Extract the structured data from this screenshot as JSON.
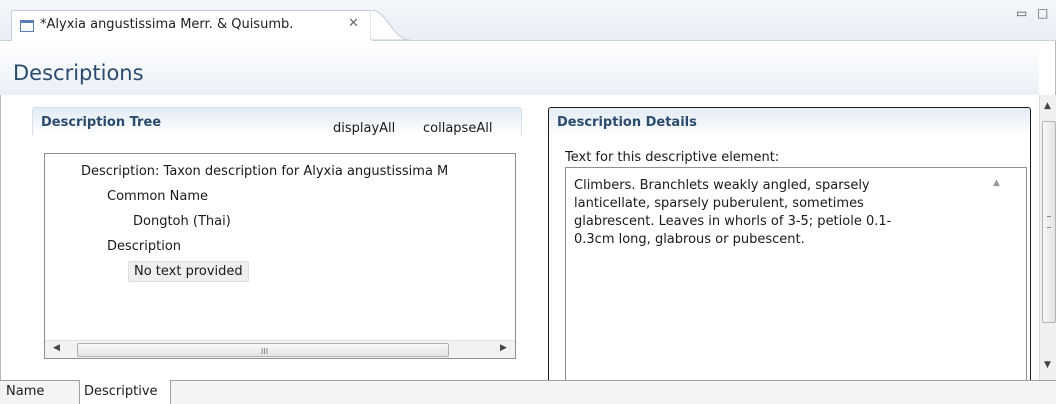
{
  "editor": {
    "tab_title": "*Alyxia angustissima Merr. & Quisumb.",
    "tab_close_glyph": "✕",
    "minimize_glyph": "▭",
    "maximize_glyph": "□"
  },
  "form": {
    "title": "Descriptions"
  },
  "tree_section": {
    "title": "Description Tree",
    "display_all": "displayAll",
    "collapse_all": "collapseAll",
    "items": [
      "Description: Taxon description for Alyxia angustissima M",
      "Common Name",
      "Dongtoh (Thai)",
      "Description",
      "No text provided"
    ],
    "hscroll_grip": "III"
  },
  "details_section": {
    "title": "Description Details",
    "field_label": "Text for this descriptive element:",
    "text_lines": [
      "Climbers. Branchlets weakly angled, sparsely",
      "lanticellate, sparsely puberulent, sometimes",
      "glabrescent. Leaves in whorls of 3-5; petiole 0.1-",
      "0.3cm long, glabrous or pubescent."
    ]
  },
  "bottom_tabs": [
    "Name",
    "Descriptive"
  ],
  "colors": {
    "title_blue": "#2b4b6e",
    "header_gradient": "#e2ebf5",
    "border": "#8f8f8f"
  },
  "icons": [
    "editor-icon",
    "close-icon",
    "minimize-icon",
    "maximize-icon",
    "scroll-up-arrow-icon",
    "scroll-down-arrow-icon",
    "scroll-left-arrow-icon",
    "scroll-right-arrow-icon"
  ]
}
